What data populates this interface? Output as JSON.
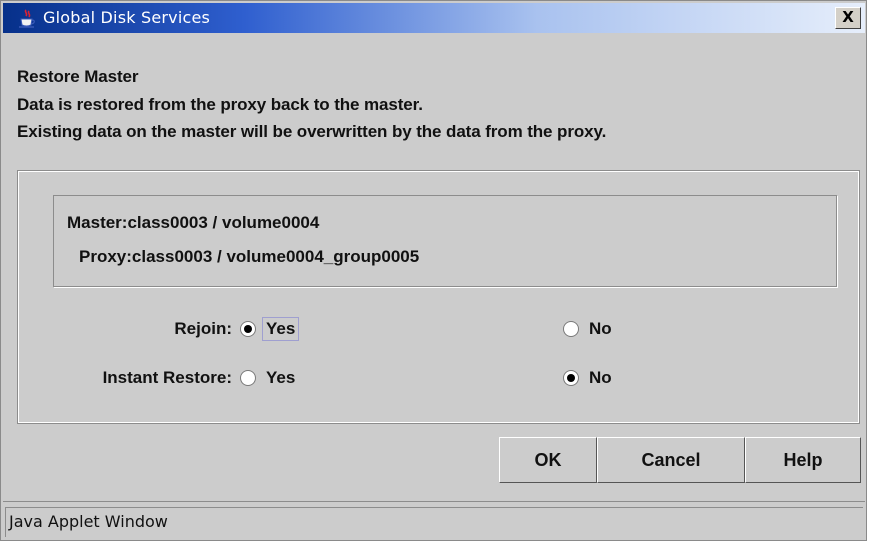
{
  "window": {
    "title": "Global Disk Services",
    "icon": "java-cup-icon",
    "close_symbol": "X"
  },
  "message": {
    "heading": "Restore Master",
    "line1": "Data is restored from the proxy back to the master.",
    "line2": "Existing data on the master will be overwritten by the data from the proxy."
  },
  "details": {
    "master": "Master:class0003 / volume0004",
    "proxy": "Proxy:class0003 / volume0004_group0005"
  },
  "options": {
    "rejoin": {
      "label": "Rejoin:",
      "choices": [
        "Yes",
        "No"
      ],
      "selected": "Yes"
    },
    "instant_restore": {
      "label": "Instant Restore:",
      "choices": [
        "Yes",
        "No"
      ],
      "selected": "No"
    }
  },
  "buttons": {
    "ok": "OK",
    "cancel": "Cancel",
    "help": "Help"
  },
  "status_bar": {
    "text": "Java Applet Window"
  }
}
